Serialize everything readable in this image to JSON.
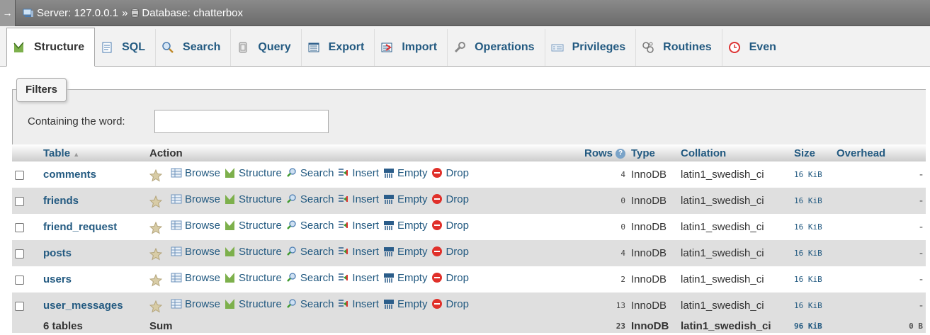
{
  "breadcrumb": {
    "arrow": "→",
    "server": "Server: 127.0.0.1",
    "separator": "»",
    "database": "Database: chatterbox"
  },
  "tabs": [
    {
      "label": "Structure",
      "icon": "structure-icon",
      "active": true
    },
    {
      "label": "SQL",
      "icon": "sql-icon"
    },
    {
      "label": "Search",
      "icon": "search-icon"
    },
    {
      "label": "Query",
      "icon": "query-icon"
    },
    {
      "label": "Export",
      "icon": "export-icon"
    },
    {
      "label": "Import",
      "icon": "import-icon"
    },
    {
      "label": "Operations",
      "icon": "wrench-icon"
    },
    {
      "label": "Privileges",
      "icon": "privileges-icon"
    },
    {
      "label": "Routines",
      "icon": "routines-icon"
    },
    {
      "label": "Even",
      "icon": "events-icon"
    }
  ],
  "filters": {
    "legend": "Filters",
    "label": "Containing the word:",
    "value": ""
  },
  "table": {
    "headers": {
      "table": "Table",
      "sort_indicator": "▲",
      "action": "Action",
      "rows": "Rows",
      "type": "Type",
      "collation": "Collation",
      "size": "Size",
      "overhead": "Overhead"
    },
    "actions": [
      "Browse",
      "Structure",
      "Search",
      "Insert",
      "Empty",
      "Drop"
    ],
    "rows": [
      {
        "name": "comments",
        "rows": "4",
        "type": "InnoDB",
        "collation": "latin1_swedish_ci",
        "size": "16 KiB",
        "overhead": "-"
      },
      {
        "name": "friends",
        "rows": "0",
        "type": "InnoDB",
        "collation": "latin1_swedish_ci",
        "size": "16 KiB",
        "overhead": "-"
      },
      {
        "name": "friend_request",
        "rows": "0",
        "type": "InnoDB",
        "collation": "latin1_swedish_ci",
        "size": "16 KiB",
        "overhead": "-"
      },
      {
        "name": "posts",
        "rows": "4",
        "type": "InnoDB",
        "collation": "latin1_swedish_ci",
        "size": "16 KiB",
        "overhead": "-"
      },
      {
        "name": "users",
        "rows": "2",
        "type": "InnoDB",
        "collation": "latin1_swedish_ci",
        "size": "16 KiB",
        "overhead": "-"
      },
      {
        "name": "user_messages",
        "rows": "13",
        "type": "InnoDB",
        "collation": "latin1_swedish_ci",
        "size": "16 KiB",
        "overhead": "-"
      }
    ],
    "footer": {
      "count": "6 tables",
      "label": "Sum",
      "rows": "23",
      "type": "InnoDB",
      "collation": "latin1_swedish_ci",
      "size": "96 KiB",
      "overhead": "0 B"
    }
  },
  "colors": {
    "link": "#235a81",
    "row_even": "#dfdfdf",
    "topbar": "#7a7a7a",
    "drop_red": "#e0302a",
    "star_gold": "#c9b88a"
  }
}
